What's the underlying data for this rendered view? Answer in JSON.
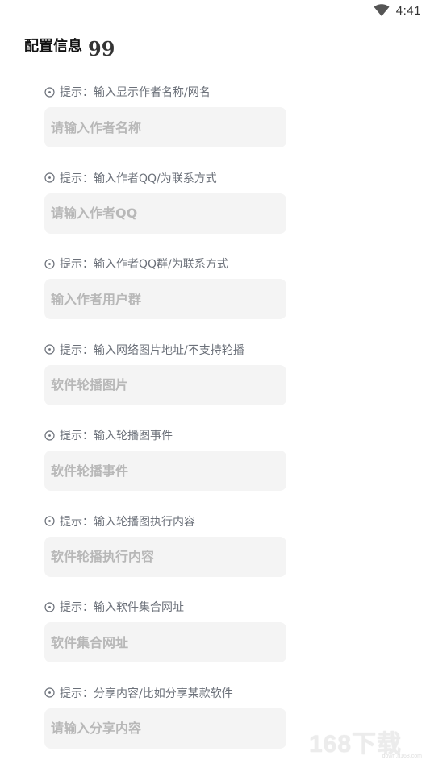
{
  "status_bar": {
    "time": "4:41"
  },
  "header": {
    "title": "配置信息",
    "title_icon": "quote-icon",
    "quote_glyph": "99"
  },
  "fields": [
    {
      "hint": "提示：输入显示作者名称/网名",
      "placeholder": "请输入作者名称",
      "value": ""
    },
    {
      "hint": "提示：输入作者QQ/为联系方式",
      "placeholder": "请输入作者QQ",
      "value": ""
    },
    {
      "hint": "提示：输入作者QQ群/为联系方式",
      "placeholder": "输入作者用户群",
      "value": ""
    },
    {
      "hint": "提示：输入网络图片地址/不支持轮播",
      "placeholder": "软件轮播图片",
      "value": ""
    },
    {
      "hint": "提示：输入轮播图事件",
      "placeholder": "软件轮播事件",
      "value": ""
    },
    {
      "hint": "提示：输入轮播图执行内容",
      "placeholder": "软件轮播执行内容",
      "value": ""
    },
    {
      "hint": "提示：输入软件集合网址",
      "placeholder": "软件集合网址",
      "value": ""
    },
    {
      "hint": "提示：分享内容/比如分享某款软件",
      "placeholder": "请输入分享内容",
      "value": ""
    }
  ],
  "hint_icon": "info-circle-icon",
  "watermark": {
    "text": "168下载",
    "sub": "down.ri168.com"
  },
  "colors": {
    "input_bg": "#f4f4f4",
    "hint_text": "#6b7079",
    "placeholder": "#b8b8b8"
  }
}
